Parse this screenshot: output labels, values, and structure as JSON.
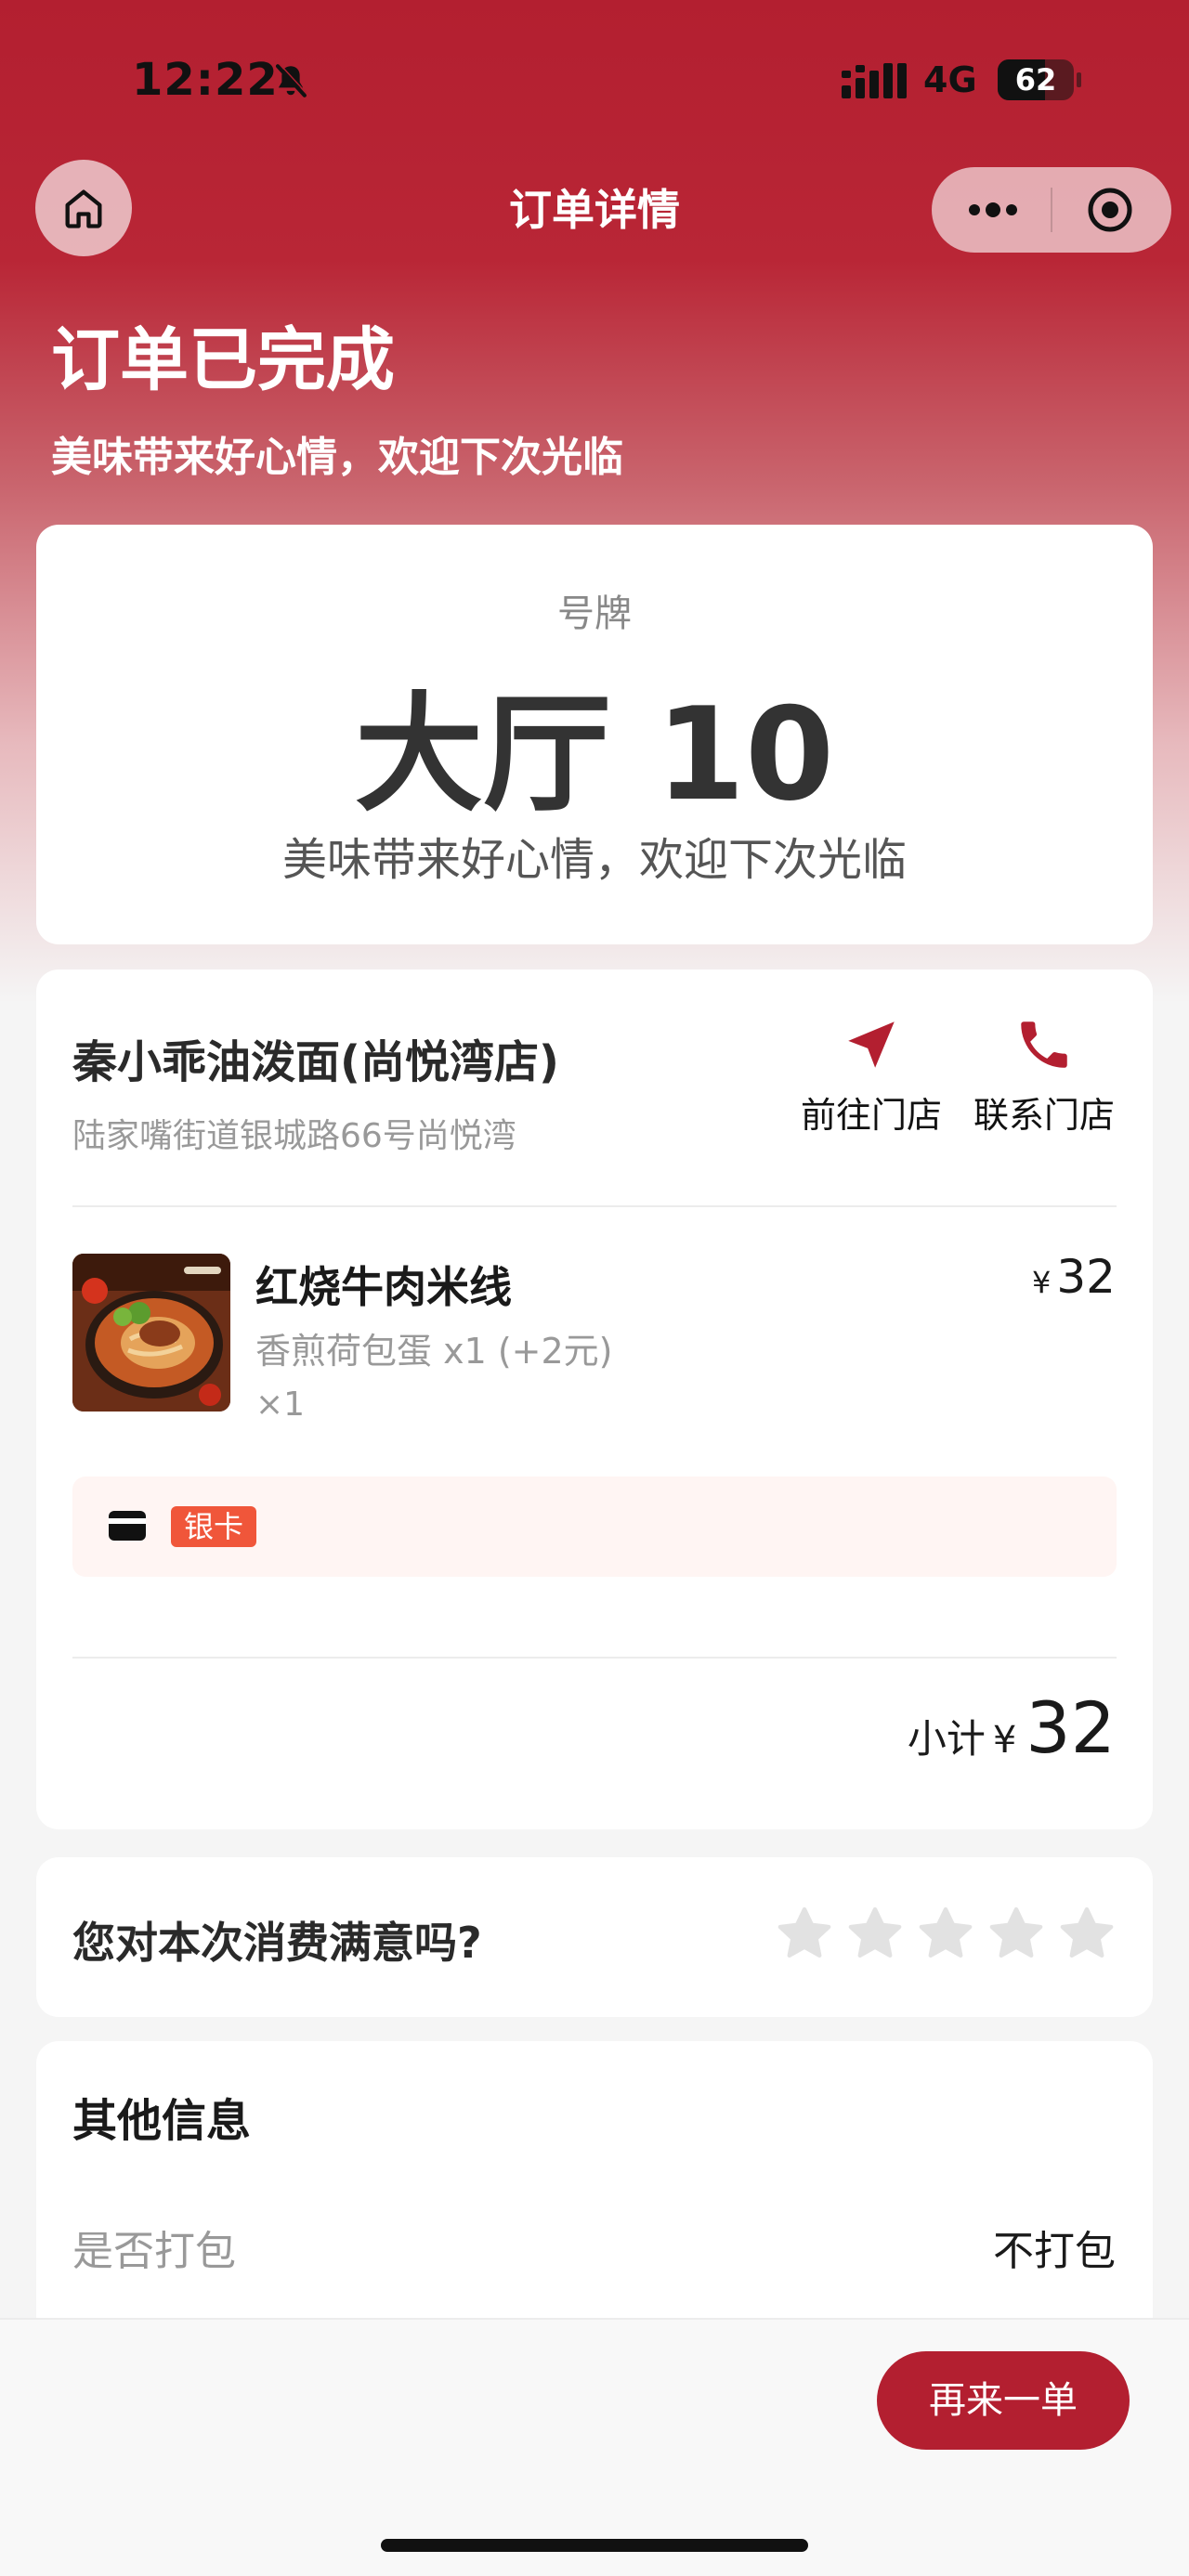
{
  "status_bar": {
    "time": "12:22",
    "network": "4G",
    "battery": "62",
    "battery_level": 0.62
  },
  "nav": {
    "title": "订单详情"
  },
  "order": {
    "status": "订单已完成",
    "slogan": "美味带来好心情，欢迎下次光临"
  },
  "ticket": {
    "label": "号牌",
    "number": "大厅 10",
    "slogan": "美味带来好心情，欢迎下次光临"
  },
  "store": {
    "name": "秦小乖油泼面(尚悦湾店)",
    "address": "陆家嘴街道银城路66号尚悦湾",
    "go_label": "前往门店",
    "call_label": "联系门店"
  },
  "items": [
    {
      "name": "红烧牛肉米线",
      "spec": "香煎荷包蛋 x1 (+2元)",
      "qty": "×1",
      "currency": "¥",
      "price": "32"
    }
  ],
  "promo": {
    "badge": "银卡"
  },
  "subtotal": {
    "label": "小计",
    "currency": "¥",
    "value": "32"
  },
  "rating": {
    "question": "您对本次消费满意吗?",
    "max_stars": 5,
    "selected": 0
  },
  "other_info": {
    "title": "其他信息",
    "rows": [
      {
        "key": "是否打包",
        "value": "不打包"
      }
    ]
  },
  "bottom": {
    "reorder_label": "再来一单"
  },
  "colors": {
    "brand": "#b31f30",
    "badge": "#f0563a",
    "promo_bg": "#fff5f3"
  }
}
